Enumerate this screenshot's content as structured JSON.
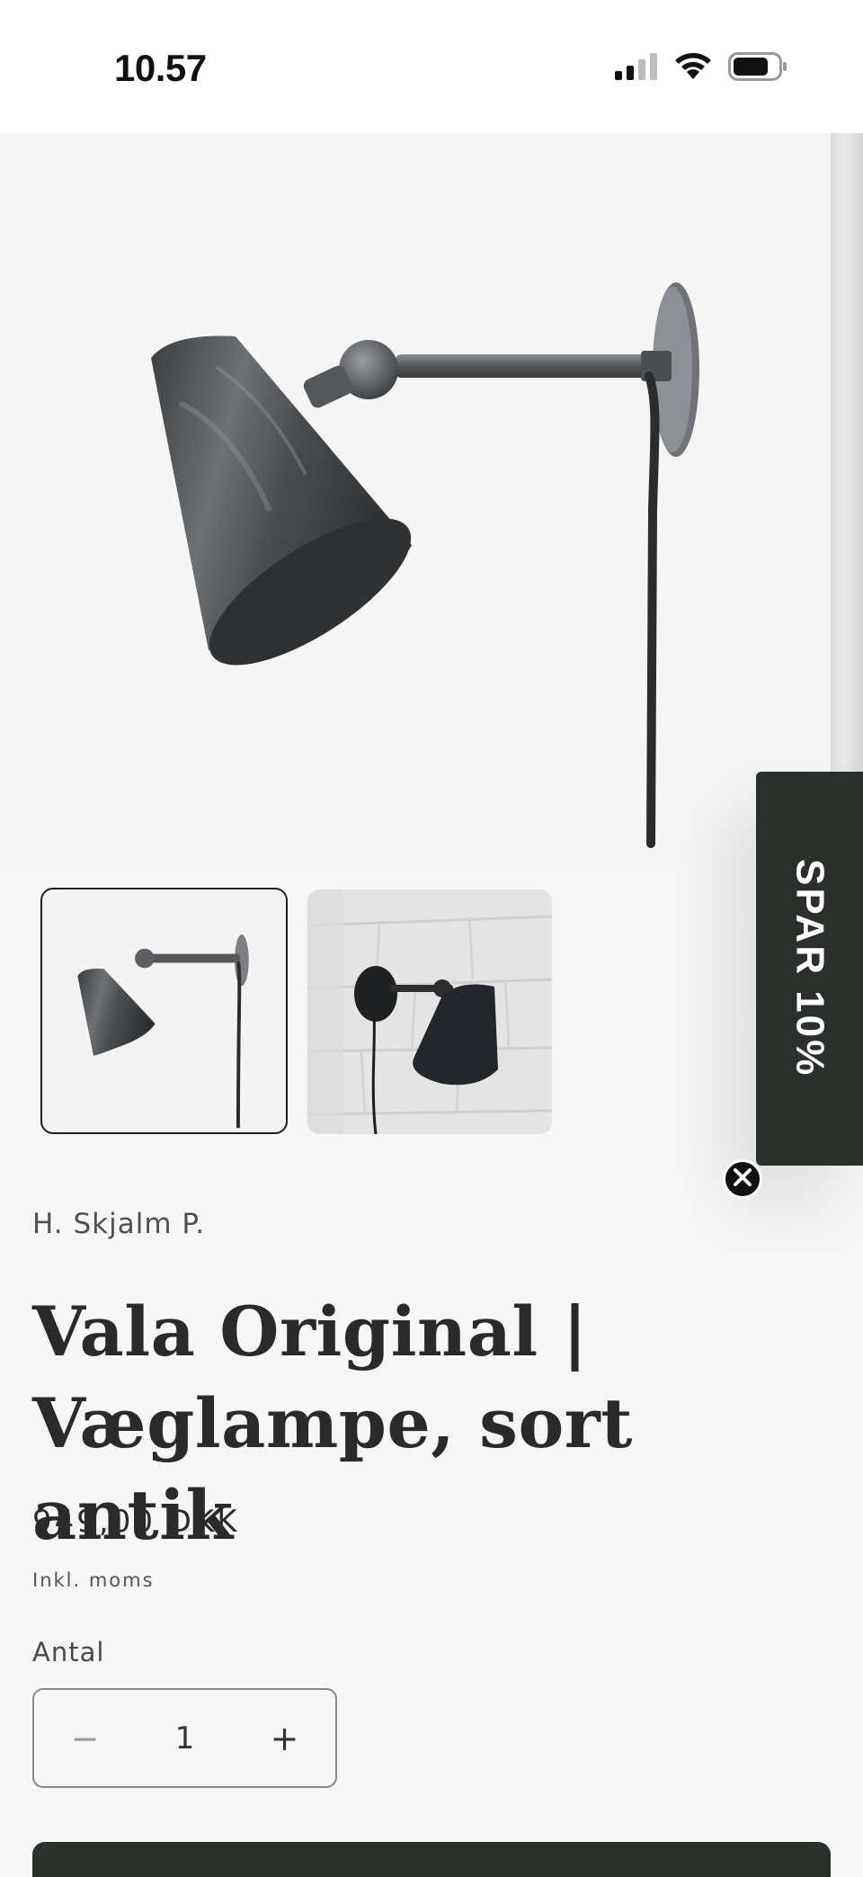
{
  "status_bar": {
    "time": "10.57",
    "icons": [
      "cellular-signal-icon",
      "wifi-icon",
      "battery-icon"
    ]
  },
  "gallery": {
    "main_image": "vala-lamp-product-photo",
    "thumbnails": [
      {
        "name": "thumbnail-lamp-product",
        "selected": true
      },
      {
        "name": "thumbnail-lamp-on-wall",
        "selected": false
      }
    ]
  },
  "promo": {
    "label": "SPAR 10%",
    "close_icon": "close-icon"
  },
  "product": {
    "vendor": "H. Skjalm P.",
    "title": "Vala Original | Væglampe, sort antik",
    "price": "949,00 DKK",
    "tax_note": "Inkl. moms"
  },
  "quantity": {
    "label": "Antal",
    "value": "1",
    "decrease_symbol": "−",
    "increase_symbol": "+"
  },
  "colors": {
    "background": "#f6f6f6",
    "dark_accent": "#2c302d",
    "text": "#2b2b2b"
  }
}
